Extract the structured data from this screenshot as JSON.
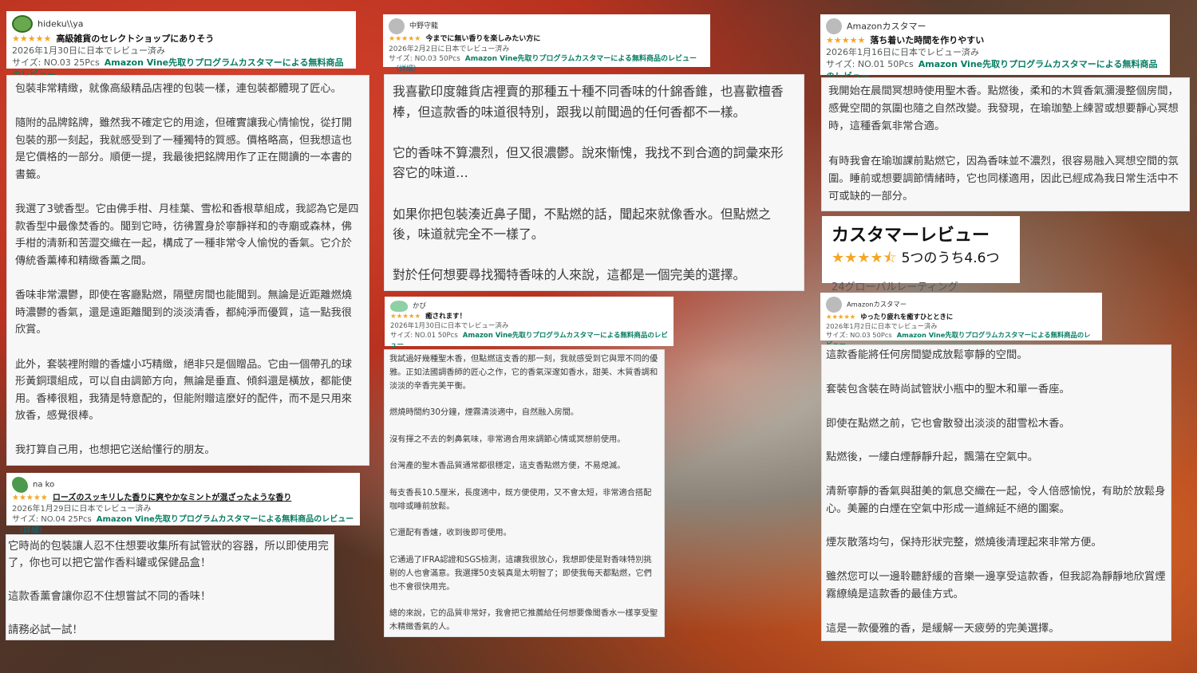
{
  "reviews": [
    {
      "username": "hideku\\\\ya",
      "stars": "★★★★★",
      "title": "高級雑貨のセレクトショップにありそう",
      "date": "2026年1月30日に日本でレビュー済み",
      "size": "サイズ: NO.03 25Pcs",
      "vine": "Amazon Vine先取りプログラムカスタマーによる無料商品のレビュー",
      "detail": "",
      "paragraphs": [
        "包裝非常精緻，就像高級精品店裡的包裝一樣，連包裝都體現了匠心。",
        "隨附的品牌銘牌，雖然我不確定它的用途，但確實讓我心情愉悅，從打開包裝的那一刻起，我就感受到了一種獨特的質感。價格略高，但我想這也是它價格的一部分。順便一提，我最後把銘牌用作了正在閱讀的一本書的書籤。",
        "我選了3號香型。它由佛手柑、月桂葉、雪松和香根草組成，我認為它是四款香型中最像焚香的。聞到它時，彷彿置身於寧靜祥和的寺廟或森林，佛手柑的清新和苦澀交織在一起，構成了一種非常令人愉悅的香氣。它介於傳統香薰棒和精緻香薰之間。",
        "香味非常濃鬱，即使在客廳點燃，隔壁房間也能聞到。無論是近距離燃燒時濃鬱的香氣，還是遠距離聞到的淡淡清香，都純淨而優質，這一點我很欣賞。",
        "此外，套裝裡附贈的香爐小巧精緻，絕非只是個贈品。它由一個帶孔的球形黃銅環組成，可以自由調節方向，無論是垂直、傾斜還是橫放，都能使用。香棒很粗，我猜是特意配的，但能附贈這麼好的配件，而不是只用來放香，感覺很棒。",
        "我打算自己用，也想把它送給懂行的朋友。"
      ]
    },
    {
      "username": "na ko",
      "stars": "★★★★★",
      "title": "ローズのスッキリした香りに爽やかなミントが混ざったような香り",
      "date": "2026年1月29日に日本でレビュー済み",
      "size": "サイズ: NO.04 25Pcs",
      "vine": "Amazon Vine先取りプログラムカスタマーによる無料商品のレビュー",
      "detail": "（詳細）",
      "paragraphs": [
        "它時尚的包裝讓人忍不住想要收集所有試管狀的容器，所以即使用完了，你也可以把它當作香料罐或保健品盒！",
        "這款香薰會讓你忍不住想嘗試不同的香味！",
        "請務必試一試！"
      ]
    },
    {
      "username": "中野守龍",
      "stars": "★★★★★",
      "title": "今までに無い香りを楽しみたい方に",
      "date": "2026年2月2日に日本でレビュー済み",
      "size": "サイズ: NO.03 50Pcs",
      "vine": "Amazon Vine先取りプログラムカスタマーによる無料商品のレビュー",
      "detail": "（詳細）",
      "paragraphs": [
        "我喜歡印度雜貨店裡賣的那種五十種不同香味的什錦香錐，也喜歡檀香棒，但這款香的味道很特別，跟我以前聞過的任何香都不一樣。",
        "它的香味不算濃烈，但又很濃鬱。說來慚愧，我找不到合適的詞彙來形容它的味道…",
        "如果你把包裝湊近鼻子聞，不點燃的話，聞起來就像香水。但點燃之後，味道就完全不一樣了。",
        "對於任何想要尋找獨特香味的人來說，這都是一個完美的選擇。"
      ]
    },
    {
      "username": "かび",
      "stars": "★★★★★",
      "title": "癒されます！",
      "date": "2026年1月30日に日本でレビュー済み",
      "size": "サイズ: NO.01 50Pcs",
      "vine": "Amazon Vine先取りプログラムカスタマーによる無料商品のレビュー",
      "detail": "",
      "paragraphs": [
        "我試過好幾種聖木香，但點燃這支香的那一刻，我就感受到它與眾不同的優雅。正如法國調香師的匠心之作，它的香氣深邃如香水，甜美、木質香調和淡淡的辛香完美平衡。",
        "燃燒時間約30分鐘，煙霧清淡適中，自然融入房間。",
        "沒有揮之不去的刺鼻氣味，非常適合用來調節心情或冥想前使用。",
        "台灣產的聖木香品質通常都很穩定，這支香點燃方便，不易熄滅。",
        "每支香長10.5厘米，長度適中，既方便使用，又不會太短，非常適合搭配咖啡或睡前放鬆。",
        "它還配有香爐，收到後即可使用。",
        "它通過了IFRA認證和SGS檢測，這讓我很放心，我想即使是對香味特別挑剔的人也會滿意。我選擇50支裝真是太明智了；即使我每天都點燃，它們也不會很快用完。",
        "總的來說，它的品質非常好，我會把它推薦給任何想要像聞香水一樣享受聖木精緻香氣的人。"
      ]
    },
    {
      "username": "Amazonカスタマー",
      "stars": "★★★★★",
      "title": "落ち着いた時間を作りやすい",
      "date": "2026年1月16日に日本でレビュー済み",
      "size": "サイズ: NO.01 50Pcs",
      "vine": "Amazon Vine先取りプログラムカスタマーによる無料商品のレビュー",
      "detail": "",
      "paragraphs": [
        "我開始在晨間冥想時使用聖木香。點燃後，柔和的木質香氣瀰漫整個房間，感覺空間的氛圍也隨之自然改變。我發現，在瑜珈墊上練習或想要靜心冥想時，這種香氣非常合適。",
        "有時我會在瑜珈課前點燃它，因為香味並不濃烈，很容易融入冥想空間的氛圍。睡前或想要調節情緒時，它也同樣適用，因此已經成為我日常生活中不可或缺的一部分。"
      ]
    },
    {
      "username": "Amazonカスタマー",
      "stars": "★★★★★",
      "title": "ゆったり疲れを癒すひとときに",
      "date": "2026年1月2日に日本でレビュー済み",
      "size": "サイズ: NO.03 50Pcs",
      "vine": "Amazon Vine先取りプログラムカスタマーによる無料商品のレビュー",
      "detail": "",
      "paragraphs": [
        "這款香能將任何房間變成放鬆寧靜的空間。",
        "套裝包含裝在時尚試管狀小瓶中的聖木和單一香座。",
        "即使在點燃之前，它也會散發出淡淡的甜雪松木香。",
        "點燃後，一縷白煙靜靜升起，飄蕩在空氣中。",
        "清新寧靜的香氣與甜美的氣息交織在一起，令人倍感愉悅，有助於放鬆身心。美麗的白煙在空氣中形成一道綿延不絕的圖案。",
        "煙灰散落均勻，保持形狀完整，燃燒後清理起來非常方便。",
        "雖然您可以一邊聆聽舒緩的音樂一邊享受這款香，但我認為靜靜地欣賞煙霧繚繞是這款香的最佳方式。",
        "這是一款優雅的香，是緩解一天疲勞的完美選擇。"
      ]
    }
  ],
  "summary": {
    "title": "カスタマーレビュー",
    "stars": "★★★★⯪",
    "rating": "5つのうち4.6つ",
    "count": "24グローバルレーティング"
  },
  "colors": {
    "star": "#f5a623",
    "vine": "#067d62",
    "link": "#007185"
  }
}
